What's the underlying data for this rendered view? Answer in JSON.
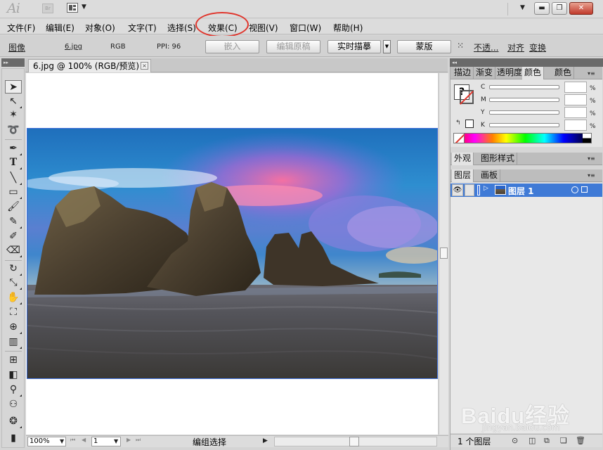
{
  "app": {
    "logo_text": "Ai",
    "bridge_badge": "Br"
  },
  "menu": {
    "items": [
      "文件(F)",
      "编辑(E)",
      "对象(O)",
      "文字(T)",
      "选择(S)",
      "效果(C)",
      "视图(V)",
      "窗口(W)",
      "帮助(H)"
    ],
    "highlighted_item": "效果(C)",
    "highlight_color": "#e0342b"
  },
  "control_bar": {
    "object_type": "图像",
    "file_name": "6.jpg",
    "color_mode": "RGB",
    "ppi": "PPI: 96",
    "embed_button": "嵌入",
    "edit_original_button": "编辑原稿",
    "live_trace_button": "实时描摹",
    "mask_button": "蒙版",
    "opacity_link": "不透...",
    "align_link": "对齐",
    "transform_link": "变换"
  },
  "document": {
    "tab_title": "6.jpg @ 100% (RGB/预览)",
    "close_glyph": "×"
  },
  "status_bar": {
    "zoom": "100%",
    "artboard": "1",
    "status_text": "编组选择"
  },
  "panels": {
    "color_group_tabs": [
      "描边",
      "渐变",
      "透明度",
      "颜色",
      "颜色"
    ],
    "active_color_tab": "颜色",
    "cmyk_labels": [
      "C",
      "M",
      "Y",
      "K"
    ],
    "percent_sign": "%",
    "fill_unknown_glyph": "?",
    "appearance_tabs": [
      "外观",
      "图形样式"
    ],
    "layers_tabs": [
      "图层",
      "画板"
    ],
    "layer_name": "图层 1",
    "layer_count": "1 个图层",
    "layer_selection_color": "#3f7ad6"
  },
  "tools": [
    "selection-tool",
    "direct-selection-tool",
    "magic-wand-tool",
    "lasso-tool",
    "pen-tool",
    "type-tool",
    "line-tool",
    "rectangle-tool",
    "paintbrush-tool",
    "pencil-tool",
    "blob-brush-tool",
    "eraser-tool",
    "rotate-tool",
    "scale-tool",
    "warp-tool",
    "free-transform-tool",
    "shape-builder-tool",
    "graph-tool",
    "mesh-tool",
    "gradient-tool",
    "eyedropper-tool",
    "blend-tool",
    "symbol-sprayer-tool",
    "column-graph-tool"
  ],
  "watermark": {
    "logo": "Baidu经验",
    "url": "jingyan.baidu.com"
  }
}
